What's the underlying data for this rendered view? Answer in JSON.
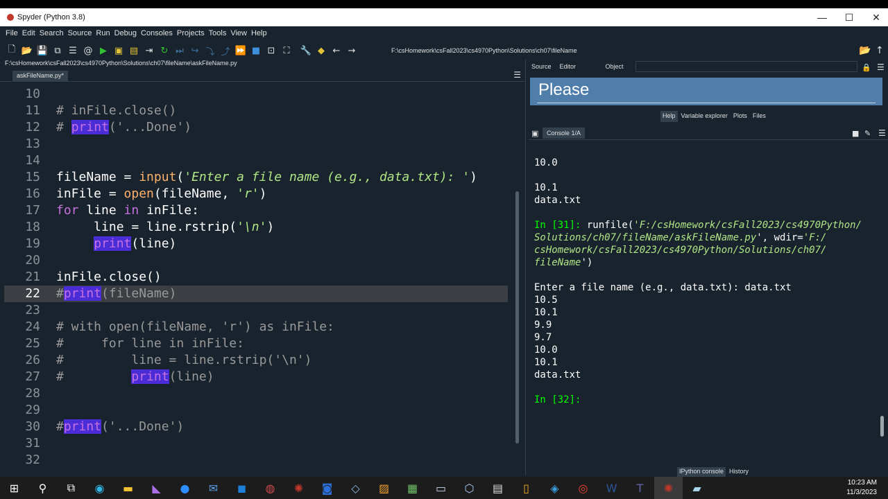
{
  "window": {
    "title": "Spyder (Python 3.8)",
    "minimize": "—",
    "maximize": "☐",
    "close": "✕"
  },
  "menu": [
    "File",
    "Edit",
    "Search",
    "Source",
    "Run",
    "Debug",
    "Consoles",
    "Projects",
    "Tools",
    "View",
    "Help"
  ],
  "toolbar": {
    "working_dir": "F:\\csHomework\\csFall2023\\cs4970Python\\Solutions\\ch07\\fileName"
  },
  "editor": {
    "file_path": "F:\\csHomework\\csFall2023\\cs4970Python\\Solutions\\ch07\\fileName\\askFileName.py",
    "tab_label": "askFileName.py*",
    "current_line": "22"
  },
  "help_panel": {
    "source_label": "Source",
    "source_value": "Editor",
    "object_label": "Object",
    "banner_title": "Please",
    "tabs": [
      "Help",
      "Variable explorer",
      "Plots",
      "Files"
    ]
  },
  "console_panel": {
    "tab_label": "Console 1/A",
    "lines": [
      "10.0",
      "",
      "10.1",
      "data.txt",
      "",
      "In [31]: ",
      "Solutions/ch07/fileName/askFileName.py",
      "csHomework/csFall2023/cs4970Python/Solutions/ch07/",
      "fileName",
      "",
      "Enter a file name (e.g., data.txt): data.txt",
      "10.5",
      "10.1",
      "9.9",
      "9.7",
      "10.0",
      "10.1",
      "data.txt",
      "",
      "In [32]:"
    ],
    "run_cmd_1": "runfile(",
    "run_arg_1": "'F:/csHomework/csFall2023/cs4970Python/",
    "run_mid": "', wdir=",
    "run_arg_2": "'F:/",
    "run_end": "')",
    "bottom_tabs": [
      "IPython console",
      "History"
    ]
  },
  "taskbar": {
    "time": "10:23 AM",
    "date": "11/3/2023"
  }
}
